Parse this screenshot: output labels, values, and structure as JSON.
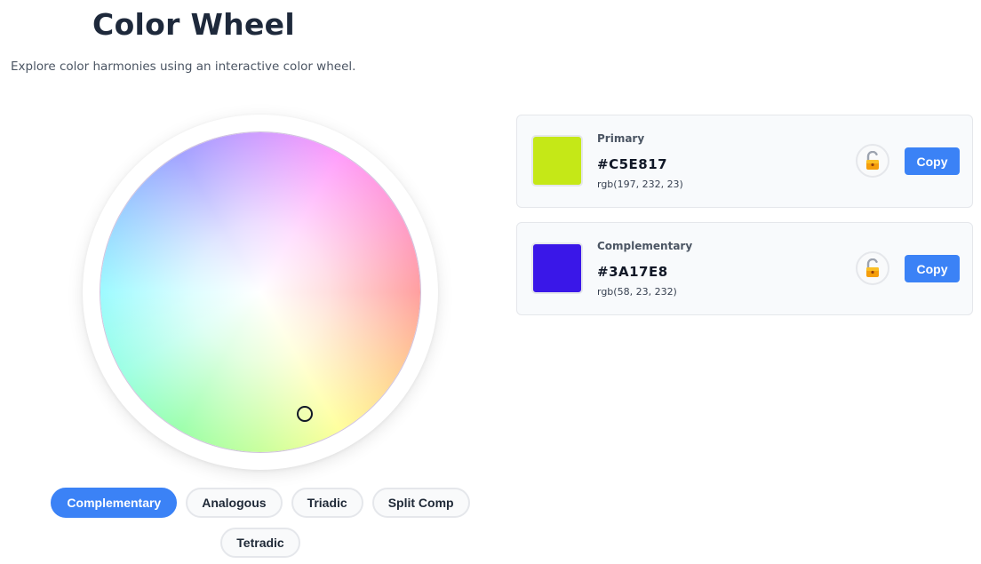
{
  "header": {
    "title": "Color Wheel",
    "subtitle": "Explore color harmonies using an interactive color wheel."
  },
  "wheel": {
    "marker_icon": "circle-marker-icon"
  },
  "harmonies": {
    "selected": "Complementary",
    "options": [
      "Complementary",
      "Analogous",
      "Triadic",
      "Split Comp",
      "Tetradic"
    ]
  },
  "colors": [
    {
      "label": "Primary",
      "hex": "#C5E817",
      "rgb": "rgb(197, 232, 23)",
      "swatch_color": "#C5E817",
      "lock_icon": "unlocked-padlock-icon",
      "copy_label": "Copy"
    },
    {
      "label": "Complementary",
      "hex": "#3A17E8",
      "rgb": "rgb(58, 23, 232)",
      "swatch_color": "#3A17E8",
      "lock_icon": "unlocked-padlock-icon",
      "copy_label": "Copy"
    }
  ],
  "theme": {
    "accent": "#3b82f6"
  }
}
